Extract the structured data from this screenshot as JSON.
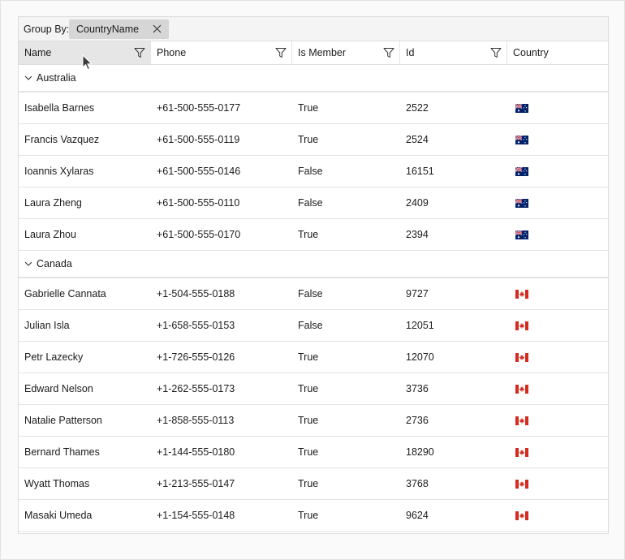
{
  "group_panel": {
    "label": "Group By:",
    "chip_label": "CountryName"
  },
  "columns": [
    {
      "label": "Name",
      "filter": true
    },
    {
      "label": "Phone",
      "filter": true
    },
    {
      "label": "Is Member",
      "filter": true
    },
    {
      "label": "Id",
      "filter": true
    },
    {
      "label": "Country",
      "filter": false
    }
  ],
  "groups": [
    {
      "name": "Australia",
      "flag": "flag-australia-icon",
      "rows": [
        {
          "name": "Isabella Barnes",
          "phone": "+61-500-555-0177",
          "member": "True",
          "id": "2522"
        },
        {
          "name": "Francis Vazquez",
          "phone": "+61-500-555-0119",
          "member": "True",
          "id": "2524"
        },
        {
          "name": "Ioannis Xylaras",
          "phone": "+61-500-555-0146",
          "member": "False",
          "id": "16151"
        },
        {
          "name": "Laura Zheng",
          "phone": "+61-500-555-0110",
          "member": "False",
          "id": "2409"
        },
        {
          "name": "Laura Zhou",
          "phone": "+61-500-555-0170",
          "member": "True",
          "id": "2394"
        }
      ]
    },
    {
      "name": "Canada",
      "flag": "flag-canada-icon",
      "rows": [
        {
          "name": "Gabrielle Cannata",
          "phone": "+1-504-555-0188",
          "member": "False",
          "id": "9727"
        },
        {
          "name": "Julian Isla",
          "phone": "+1-658-555-0153",
          "member": "False",
          "id": "12051"
        },
        {
          "name": "Petr Lazecky",
          "phone": "+1-726-555-0126",
          "member": "True",
          "id": "12070"
        },
        {
          "name": "Edward Nelson",
          "phone": "+1-262-555-0173",
          "member": "True",
          "id": "3736"
        },
        {
          "name": "Natalie Patterson",
          "phone": "+1-858-555-0113",
          "member": "True",
          "id": "2736"
        },
        {
          "name": "Bernard Thames",
          "phone": "+1-144-555-0180",
          "member": "True",
          "id": "18290"
        },
        {
          "name": "Wyatt Thomas",
          "phone": "+1-213-555-0147",
          "member": "True",
          "id": "3768"
        },
        {
          "name": "Masaki Umeda",
          "phone": "+1-154-555-0148",
          "member": "True",
          "id": "9624"
        }
      ]
    }
  ],
  "colors": {
    "header_active": "#e6e6e6",
    "chip_background": "#d6d6d6",
    "row_border": "#e3e3e3"
  }
}
